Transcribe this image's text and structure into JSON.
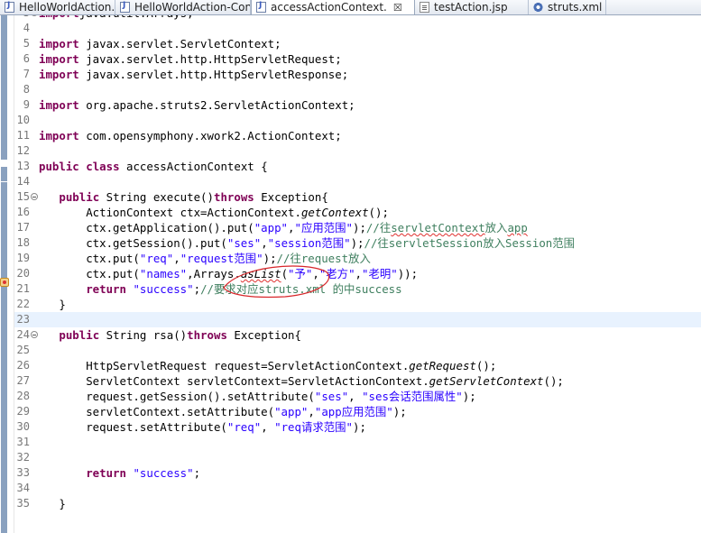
{
  "tabs": [
    {
      "label": "HelloWorldAction.jav",
      "icon": "java-file-icon",
      "active": false
    },
    {
      "label": "HelloWorldAction-Con",
      "icon": "java-file-icon",
      "active": false
    },
    {
      "label": "accessActionContext.",
      "icon": "java-file-icon",
      "active": true,
      "close": "☒"
    },
    {
      "label": "testAction.jsp",
      "icon": "jsp-file-icon",
      "active": false
    },
    {
      "label": "struts.xml",
      "icon": "xml-file-icon",
      "active": false
    }
  ],
  "lines": [
    {
      "n": "3",
      "fold": true,
      "seg": [
        [
          "k",
          "import"
        ],
        [
          "",
          "java.util.Arrays;"
        ]
      ]
    },
    {
      "n": "4",
      "seg": []
    },
    {
      "n": "5",
      "seg": [
        [
          "k",
          "import"
        ],
        [
          "",
          " javax.servlet.ServletContext;"
        ]
      ]
    },
    {
      "n": "6",
      "seg": [
        [
          "k",
          "import"
        ],
        [
          "",
          " javax.servlet.http.HttpServletRequest;"
        ]
      ]
    },
    {
      "n": "7",
      "seg": [
        [
          "k",
          "import"
        ],
        [
          "",
          " javax.servlet.http.HttpServletResponse;"
        ]
      ]
    },
    {
      "n": "8",
      "seg": []
    },
    {
      "n": "9",
      "seg": [
        [
          "k",
          "import"
        ],
        [
          "",
          " org.apache.struts2.ServletActionContext;"
        ]
      ]
    },
    {
      "n": "10",
      "seg": []
    },
    {
      "n": "11",
      "seg": [
        [
          "k",
          "import"
        ],
        [
          "",
          " com.opensymphony.xwork2.ActionContext;"
        ]
      ]
    },
    {
      "n": "12",
      "seg": []
    },
    {
      "n": "13",
      "seg": [
        [
          "k",
          "public"
        ],
        [
          "",
          " "
        ],
        [
          "k",
          "class"
        ],
        [
          "",
          " accessActionContext {"
        ]
      ]
    },
    {
      "n": "14",
      "seg": []
    },
    {
      "n": "15",
      "fold": true,
      "seg": [
        [
          "",
          "   "
        ],
        [
          "k",
          "public"
        ],
        [
          "",
          " String execute()"
        ],
        [
          "k",
          "throws"
        ],
        [
          "",
          " Exception{"
        ]
      ]
    },
    {
      "n": "16",
      "seg": [
        [
          "",
          "       ActionContext ctx=ActionContext."
        ],
        [
          "i",
          "getContext"
        ],
        [
          "",
          "();"
        ]
      ]
    },
    {
      "n": "17",
      "seg": [
        [
          "",
          "       ctx.getApplication().put("
        ],
        [
          "s",
          "\"app\""
        ],
        [
          "",
          ","
        ],
        [
          "s",
          "\"应用范围\""
        ],
        [
          "",
          ");"
        ],
        [
          "c",
          "//往"
        ],
        [
          "c sp",
          "servletContext"
        ],
        [
          "c",
          "放入"
        ],
        [
          "c sp",
          "app"
        ]
      ]
    },
    {
      "n": "18",
      "seg": [
        [
          "",
          "       ctx.getSession().put("
        ],
        [
          "s",
          "\"ses\""
        ],
        [
          "",
          ","
        ],
        [
          "s",
          "\"session范围\""
        ],
        [
          "",
          ");"
        ],
        [
          "c",
          "//往servletSession放入Session范围"
        ]
      ]
    },
    {
      "n": "19",
      "seg": [
        [
          "",
          "       ctx.put("
        ],
        [
          "s",
          "\"req\""
        ],
        [
          "",
          ","
        ],
        [
          "s",
          "\"request范围\""
        ],
        [
          "",
          ");"
        ],
        [
          "c",
          "//往request放入"
        ]
      ]
    },
    {
      "n": "20",
      "marker": true,
      "seg": [
        [
          "",
          "       ctx.put("
        ],
        [
          "s",
          "\"names\""
        ],
        [
          "",
          ",Arrays."
        ],
        [
          "i sp",
          "asList"
        ],
        [
          "",
          "("
        ],
        [
          "s",
          "\"予\""
        ],
        [
          "",
          ","
        ],
        [
          "s",
          "\"老方\""
        ],
        [
          "",
          ","
        ],
        [
          "s",
          "\"老明\""
        ],
        [
          "",
          "));"
        ]
      ]
    },
    {
      "n": "21",
      "seg": [
        [
          "",
          "       "
        ],
        [
          "k",
          "return"
        ],
        [
          "",
          " "
        ],
        [
          "s",
          "\"success\""
        ],
        [
          "",
          ";"
        ],
        [
          "c",
          "//要求对应struts.xml 的中success"
        ]
      ]
    },
    {
      "n": "22",
      "seg": [
        [
          "",
          "   }"
        ]
      ]
    },
    {
      "n": "23",
      "current": true,
      "seg": []
    },
    {
      "n": "24",
      "fold": true,
      "seg": [
        [
          "",
          "   "
        ],
        [
          "k",
          "public"
        ],
        [
          "",
          " String rsa()"
        ],
        [
          "k",
          "throws"
        ],
        [
          "",
          " Exception{"
        ]
      ]
    },
    {
      "n": "25",
      "seg": []
    },
    {
      "n": "26",
      "seg": [
        [
          "",
          "       HttpServletRequest request=ServletActionContext."
        ],
        [
          "i",
          "getRequest"
        ],
        [
          "",
          "();"
        ]
      ]
    },
    {
      "n": "27",
      "seg": [
        [
          "",
          "       ServletContext servletContext=ServletActionContext."
        ],
        [
          "i",
          "getServletContext"
        ],
        [
          "",
          "();"
        ]
      ]
    },
    {
      "n": "28",
      "seg": [
        [
          "",
          "       request.getSession().setAttribute("
        ],
        [
          "s",
          "\"ses\""
        ],
        [
          "",
          ", "
        ],
        [
          "s",
          "\"ses会话范围属性\""
        ],
        [
          "",
          ");"
        ]
      ]
    },
    {
      "n": "29",
      "seg": [
        [
          "",
          "       servletContext.setAttribute("
        ],
        [
          "s",
          "\"app\""
        ],
        [
          "",
          ","
        ],
        [
          "s",
          "\"app应用范围\""
        ],
        [
          "",
          ");"
        ]
      ]
    },
    {
      "n": "30",
      "seg": [
        [
          "",
          "       request.setAttribute("
        ],
        [
          "s",
          "\"req\""
        ],
        [
          "",
          ", "
        ],
        [
          "s",
          "\"req请求范围\""
        ],
        [
          "",
          ");"
        ]
      ]
    },
    {
      "n": "31",
      "seg": []
    },
    {
      "n": "32",
      "seg": []
    },
    {
      "n": "33",
      "seg": [
        [
          "",
          "       "
        ],
        [
          "k",
          "return"
        ],
        [
          "",
          " "
        ],
        [
          "s",
          "\"success\""
        ],
        [
          "",
          ";"
        ]
      ]
    },
    {
      "n": "34",
      "seg": []
    },
    {
      "n": "35",
      "seg": [
        [
          "",
          "   }"
        ]
      ]
    }
  ]
}
